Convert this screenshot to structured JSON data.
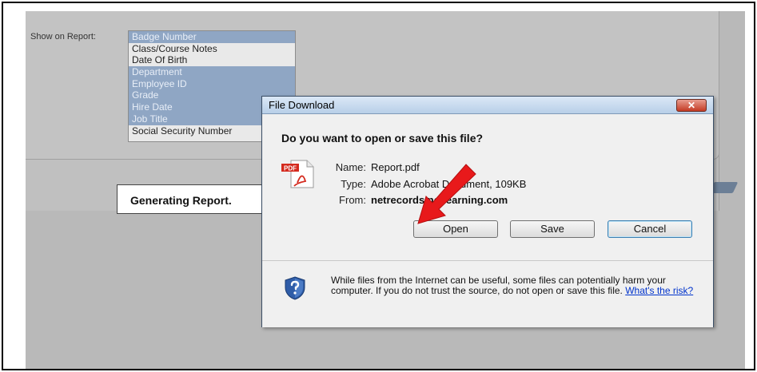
{
  "report_form": {
    "show_label": "Show on Report:",
    "fields": [
      {
        "label": "Badge Number",
        "selected": true
      },
      {
        "label": "Class/Course Notes",
        "selected": false
      },
      {
        "label": "Date Of Birth",
        "selected": false
      },
      {
        "label": "Department",
        "selected": true
      },
      {
        "label": "Employee ID",
        "selected": true
      },
      {
        "label": "Grade",
        "selected": true
      },
      {
        "label": "Hire Date",
        "selected": true
      },
      {
        "label": "Job Title",
        "selected": true
      },
      {
        "label": "Social Security Number",
        "selected": false
      }
    ],
    "status": "Generating Report."
  },
  "dialog": {
    "title": "File Download",
    "close_label": "✕",
    "question": "Do you want to open or save this file?",
    "name_label": "Name:",
    "name_value": "Report.pdf",
    "type_label": "Type:",
    "type_value": "Adobe Acrobat Document, 109KB",
    "from_label": "From:",
    "from_value": "netrecords.netlearning.com",
    "buttons": {
      "open": "Open",
      "save": "Save",
      "cancel": "Cancel"
    },
    "warning_text": "While files from the Internet can be useful, some files can potentially harm your computer. If you do not trust the source, do not open or save this file.",
    "risk_link": "What's the risk?",
    "pdf_icon_label": "PDF"
  },
  "colors": {
    "selection": "#8fa6c4",
    "arrow": "#e8191b",
    "titlebar": "#b8cfe8"
  }
}
